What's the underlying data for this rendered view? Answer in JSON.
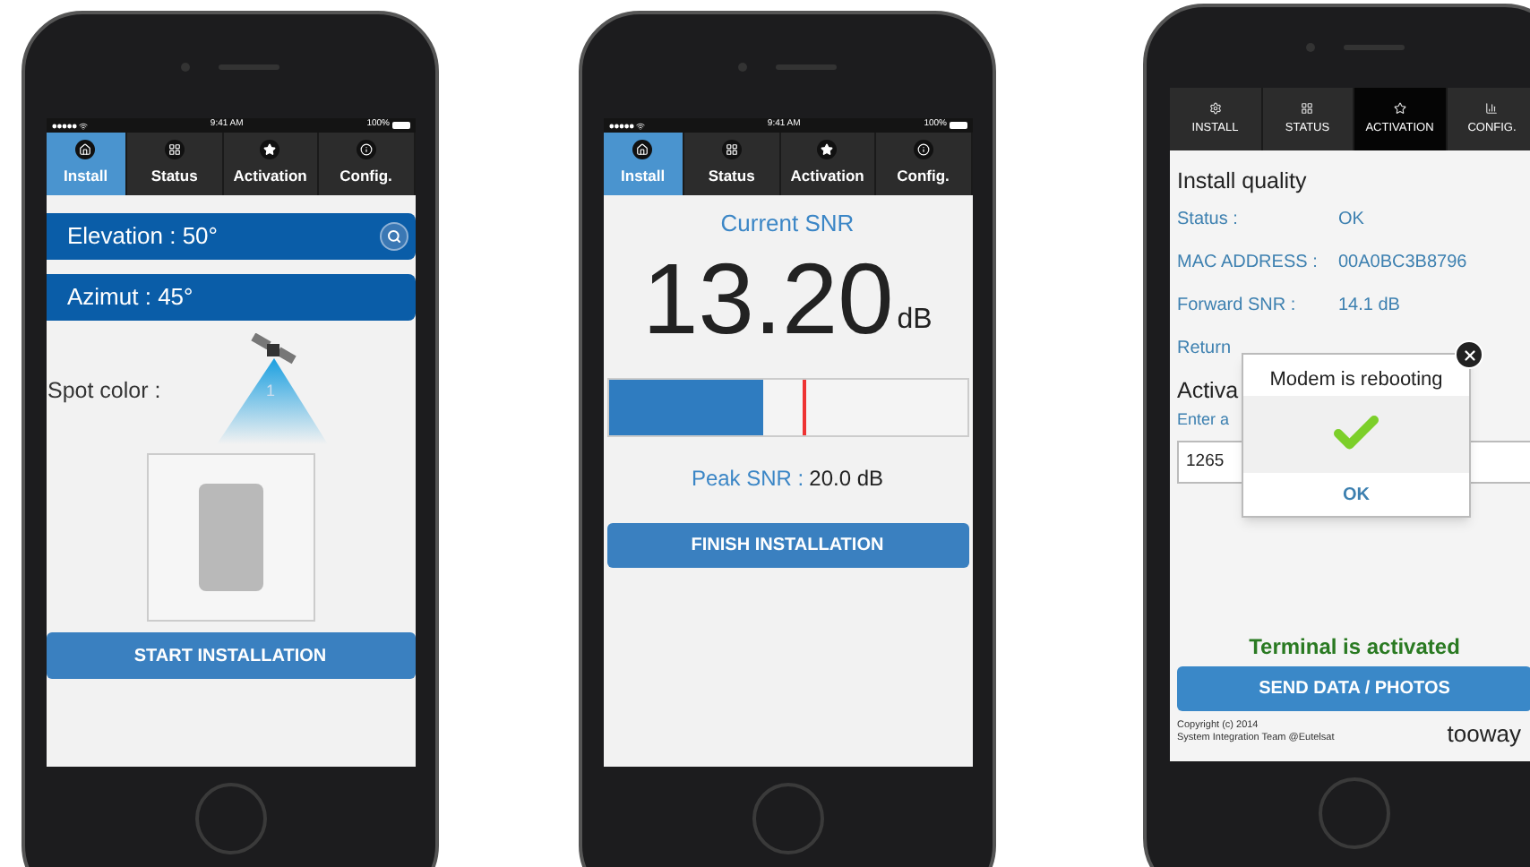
{
  "phones": [
    {
      "kind": "install",
      "status_bar": {
        "time": "9:41 AM",
        "battery": "100%"
      },
      "tabs": [
        {
          "label": "Install",
          "selected": true
        },
        {
          "label": "Status",
          "selected": false
        },
        {
          "label": "Activation",
          "selected": false
        },
        {
          "label": "Config.",
          "selected": false
        }
      ],
      "elevation": "Elevation : 50°",
      "azimut": "Azimut : 45°",
      "spot_label": "Spot color :",
      "spot_number": "1",
      "button": "START INSTALLATION"
    },
    {
      "kind": "snr",
      "status_bar": {
        "time": "9:41 AM",
        "battery": "100%"
      },
      "tabs": [
        {
          "label": "Install",
          "selected": true
        },
        {
          "label": "Status",
          "selected": false
        },
        {
          "label": "Activation",
          "selected": false
        },
        {
          "label": "Config.",
          "selected": false
        }
      ],
      "title": "Current SNR",
      "value": "13.20",
      "unit": "dB",
      "meter": {
        "level": 0.43,
        "peak_marker": {
          "level": 0.54
        }
      },
      "peak_label": "Peak SNR :",
      "peak_value": "20.0 dB",
      "button": "FINISH INSTALLATION"
    },
    {
      "kind": "activation",
      "tabs": [
        {
          "label": "INSTALL",
          "selected": false
        },
        {
          "label": "STATUS",
          "selected": false
        },
        {
          "label": "ACTIVATION",
          "selected": true
        },
        {
          "label": "CONFIG.",
          "selected": false
        }
      ],
      "heading": "Install quality",
      "rows": [
        {
          "label": "Status :",
          "value": "OK"
        },
        {
          "label": "MAC ADDRESS :",
          "value": "00A0BC3B8796"
        },
        {
          "label": "Forward SNR :",
          "value": "14.1 dB"
        },
        {
          "label": "Return"
        }
      ],
      "activation_heading": "Activa",
      "activation_hint": "Enter a",
      "code_field": {
        "value": "1265"
      },
      "dialog": {
        "message": "Modem is rebooting",
        "button": "OK"
      },
      "activated": "Terminal is activated",
      "button": "SEND DATA / PHOTOS",
      "copyright": [
        "Copyright (c) 2014",
        "System Integration Team @Eutelsat"
      ],
      "logo": "tooway"
    }
  ]
}
